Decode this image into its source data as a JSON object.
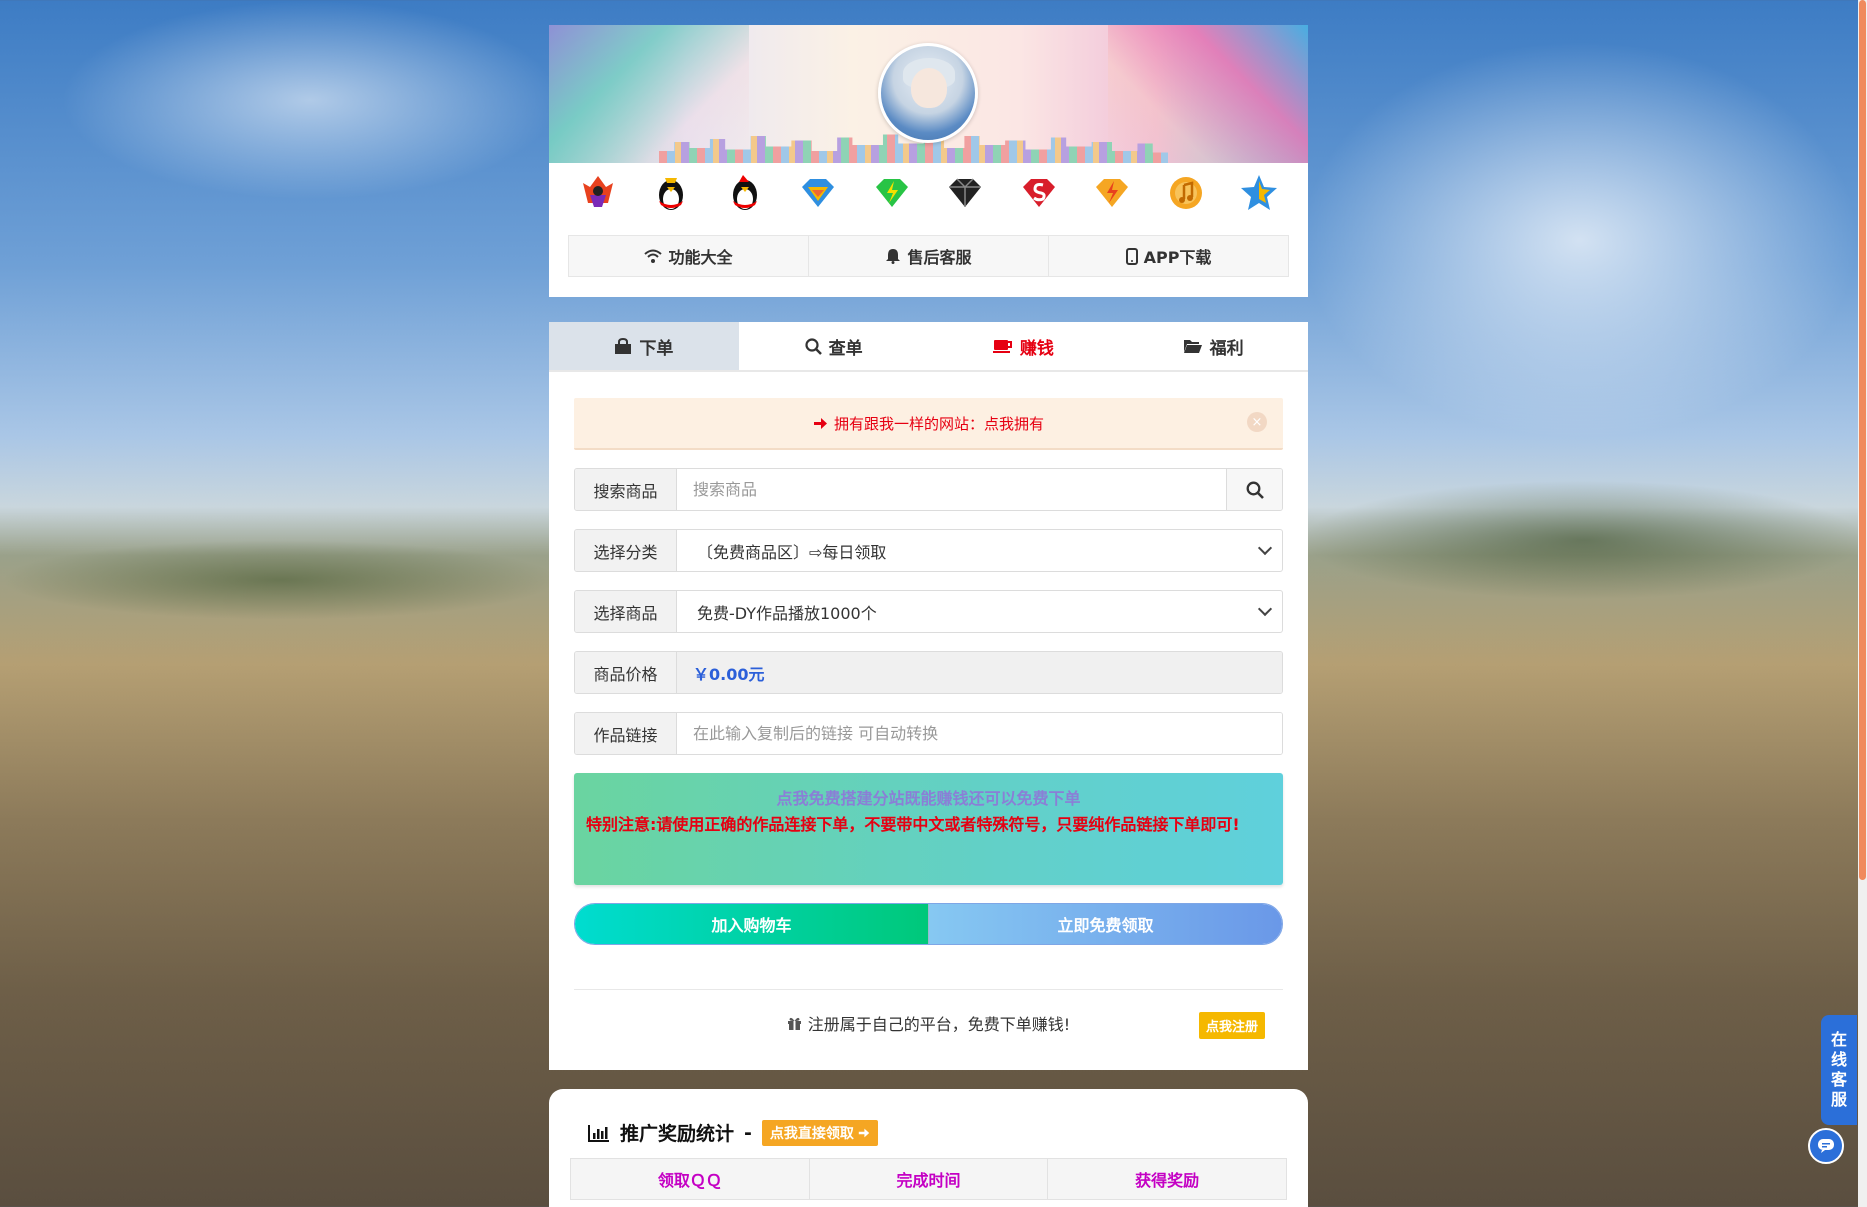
{
  "header": {
    "nav": [
      {
        "icon": "wifi-icon",
        "label": "功能大全"
      },
      {
        "icon": "bell-icon",
        "label": "售后客服"
      },
      {
        "icon": "mobile-icon",
        "label": "APP下载"
      }
    ],
    "badge_icons": [
      "qq-vip-crown-icon",
      "qq-penguin-icon",
      "qq-penguin-red-icon",
      "super-vip-diamond-icon",
      "green-diamond-icon",
      "black-diamond-icon",
      "red-diamond-icon",
      "yellow-diamond-icon",
      "music-disc-icon",
      "blue-star-icon"
    ]
  },
  "tabs": [
    {
      "icon": "shopping-bag-icon",
      "label": "下单",
      "active": true
    },
    {
      "icon": "search-icon",
      "label": "查单"
    },
    {
      "icon": "coffee-icon",
      "label": "赚钱",
      "highlight": true
    },
    {
      "icon": "folder-open-icon",
      "label": "福利"
    }
  ],
  "alert": {
    "text": "拥有跟我一样的网站：点我拥有",
    "close": "×"
  },
  "form": {
    "search": {
      "label": "搜索商品",
      "placeholder": "搜索商品"
    },
    "category": {
      "label": "选择分类",
      "value": "〔免费商品区〕⇨每日领取"
    },
    "product": {
      "label": "选择商品",
      "value": "免费-DY作品播放1000个"
    },
    "price": {
      "label": "商品价格",
      "value": "￥0.00元"
    },
    "link": {
      "label": "作品链接",
      "placeholder": "在此输入复制后的链接 可自动转换"
    }
  },
  "notice": {
    "link": "点我免费搭建分站既能赚钱还可以免费下单",
    "warning": "特别注意:请使用正确的作品连接下单，不要带中文或者特殊符号，只要纯作品链接下单即可!"
  },
  "buttons": {
    "cart": "加入购物车",
    "claim": "立即免费领取"
  },
  "register": {
    "text": "注册属于自己的平台，免费下单赚钱!",
    "button": "点我注册"
  },
  "stats": {
    "title": "推广奖励统计",
    "dash": "-",
    "badge": "点我直接领取",
    "columns": [
      "领取ＱＱ",
      "完成时间",
      "获得奖励"
    ]
  },
  "float_service": {
    "chars": [
      "在",
      "线",
      "客",
      "服"
    ]
  },
  "colors": {
    "accent_red": "#e60012",
    "price_blue": "#2b5fd9",
    "stats_header": "#c400c4",
    "service_blue": "#2b6fd9"
  }
}
